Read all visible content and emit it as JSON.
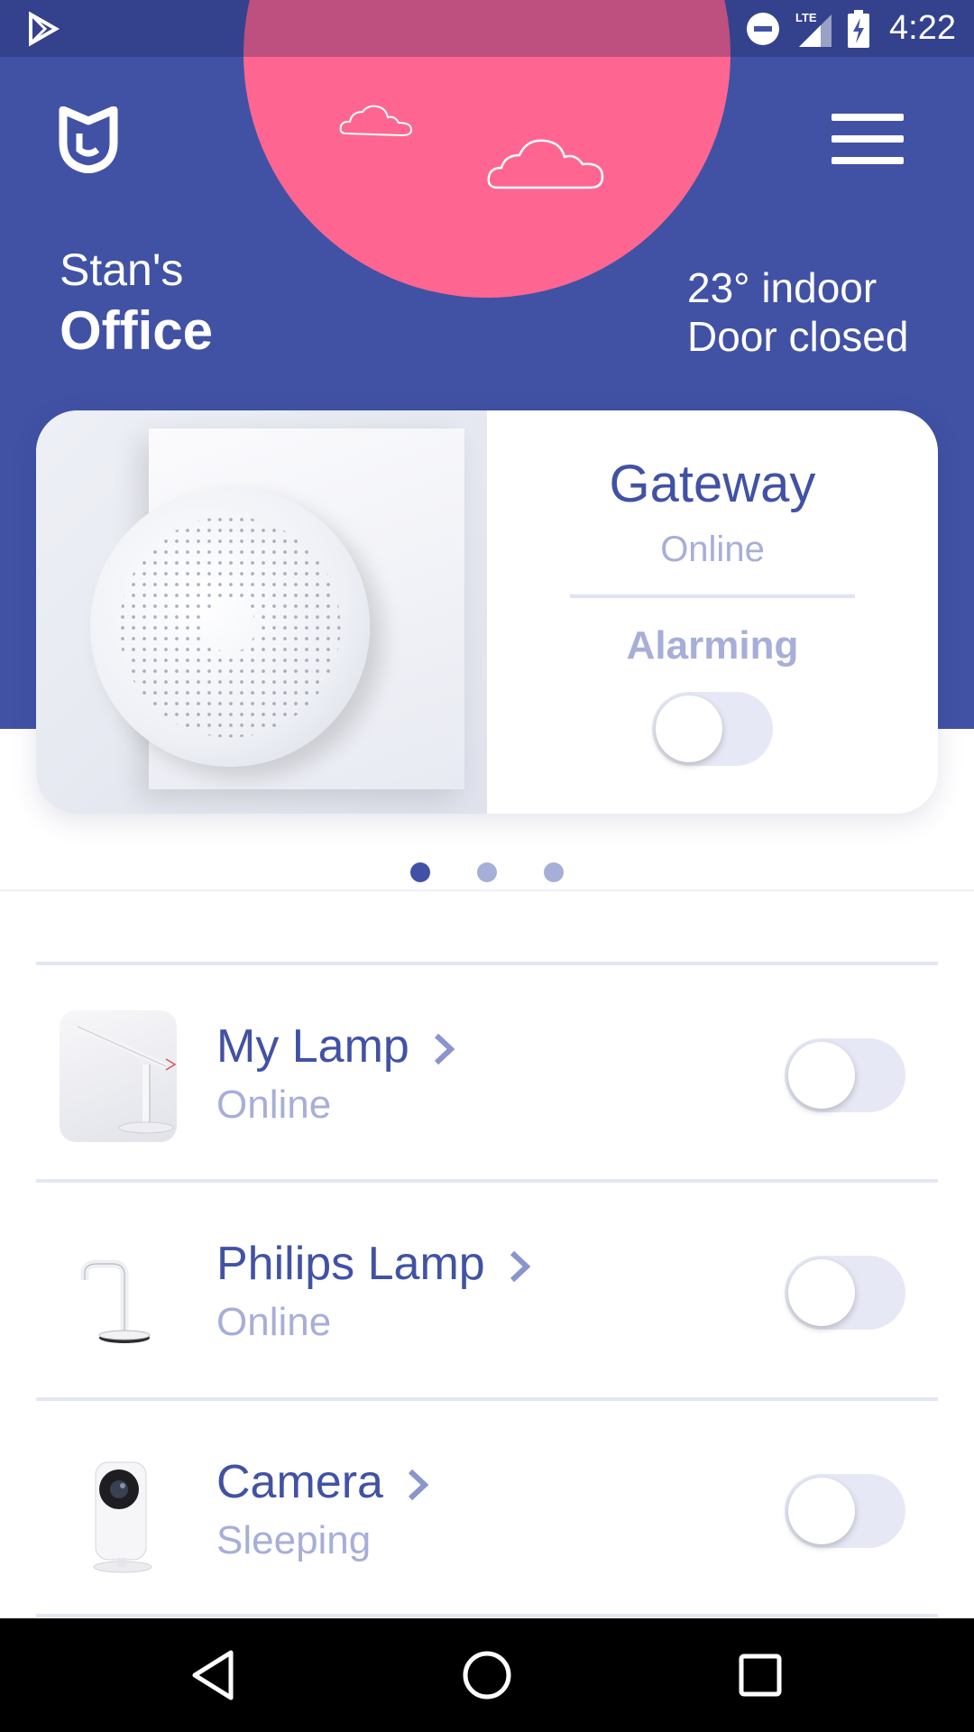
{
  "status_bar": {
    "network": "LTE",
    "time": "4:22"
  },
  "header": {
    "room_prefix": "Stan's",
    "room_name": "Office",
    "temperature_text": "23° indoor",
    "door_text": "Door closed",
    "sun_color": "#fe6691",
    "background_color": "#4152a5"
  },
  "featured_card": {
    "title": "Gateway",
    "status": "Online",
    "alarm_label": "Alarming",
    "alarm_on": false,
    "image_icon": "gateway-device-image"
  },
  "pager": {
    "count": 3,
    "active_index": 0
  },
  "devices": [
    {
      "name": "My Lamp",
      "status": "Online",
      "on": false,
      "icon": "desk-lamp-image"
    },
    {
      "name": "Philips Lamp",
      "status": "Online",
      "on": false,
      "icon": "philips-lamp-image"
    },
    {
      "name": "Camera",
      "status": "Sleeping",
      "on": false,
      "icon": "camera-image"
    }
  ],
  "nav": {
    "back_icon": "back-triangle-icon",
    "home_icon": "home-circle-icon",
    "recents_icon": "recents-square-icon"
  },
  "colors": {
    "primary": "#4152a5",
    "muted": "#a7aed8",
    "toggle_track": "#e6e9f5"
  }
}
